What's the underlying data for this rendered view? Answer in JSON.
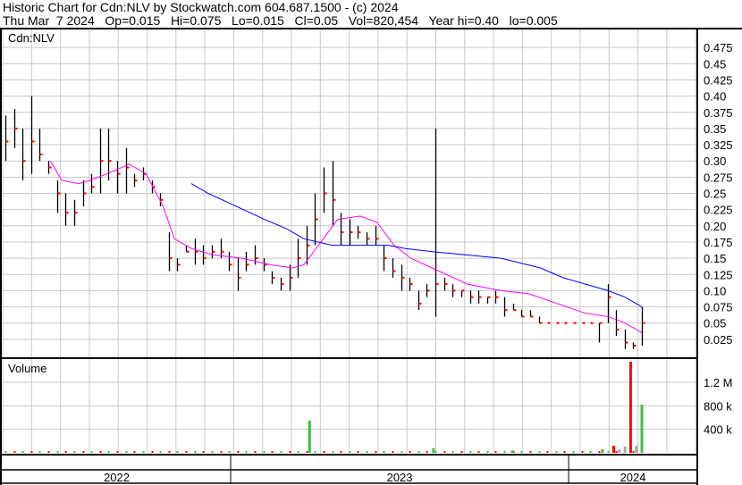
{
  "header": {
    "title": "Historic Chart for Cdn:NLV by Stockwatch.com 604.687.1500 - (c) 2024",
    "quote": "Thu Mar  7 2024   Op=0.015   Hi=0.075   Lo=0.015   Cl=0.05   Vol=820,454   Year hi=0.40   lo=0.005"
  },
  "chart_data": {
    "type": "line",
    "symbol": "Cdn:NLV",
    "price_axis": {
      "ticks": [
        "0.025",
        "0.05",
        "0.075",
        "0.10",
        "0.125",
        "0.15",
        "0.175",
        "0.20",
        "0.225",
        "0.25",
        "0.275",
        "0.30",
        "0.325",
        "0.35",
        "0.375",
        "0.40",
        "0.425",
        "0.45",
        "0.475"
      ],
      "ylim": [
        0,
        0.5
      ]
    },
    "volume_panel": {
      "label": "Volume",
      "ticks": [
        {
          "label": "400 k",
          "value": 400000
        },
        {
          "label": "800 k",
          "value": 800000
        },
        {
          "label": "1.2 M",
          "value": 1200000
        }
      ],
      "ylim": [
        0,
        1550000
      ]
    },
    "x_axis": {
      "unit": "week",
      "xlim": [
        0,
        113
      ],
      "years": [
        {
          "label": "2022",
          "start": 0,
          "end": 40
        },
        {
          "label": "2023",
          "start": 40,
          "end": 100
        },
        {
          "label": "2024",
          "start": 100,
          "end": 113
        }
      ]
    },
    "bars_hlc": [
      [
        0.37,
        0.3,
        0.33
      ],
      [
        0.38,
        0.32,
        0.35
      ],
      [
        0.35,
        0.27,
        0.3
      ],
      [
        0.4,
        0.28,
        0.33
      ],
      [
        0.35,
        0.3,
        0.31
      ],
      [
        0.3,
        0.28,
        0.29
      ],
      [
        0.27,
        0.22,
        0.25
      ],
      [
        0.25,
        0.2,
        0.22
      ],
      [
        0.24,
        0.2,
        0.22
      ],
      [
        0.27,
        0.23,
        0.25
      ],
      [
        0.28,
        0.25,
        0.26
      ],
      [
        0.35,
        0.25,
        0.3
      ],
      [
        0.35,
        0.27,
        0.3
      ],
      [
        0.3,
        0.25,
        0.28
      ],
      [
        0.32,
        0.25,
        0.29
      ],
      [
        0.28,
        0.26,
        0.27
      ],
      [
        0.29,
        0.27,
        0.28
      ],
      [
        0.27,
        0.25,
        0.26
      ],
      [
        0.25,
        0.23,
        0.24
      ],
      [
        0.19,
        0.13,
        0.15
      ],
      [
        0.15,
        0.13,
        0.14
      ],
      [
        0.17,
        0.16,
        0.16
      ],
      [
        0.18,
        0.14,
        0.16
      ],
      [
        0.17,
        0.14,
        0.15
      ],
      [
        0.17,
        0.15,
        0.16
      ],
      [
        0.18,
        0.15,
        0.16
      ],
      [
        0.16,
        0.13,
        0.14
      ],
      [
        0.15,
        0.1,
        0.12
      ],
      [
        0.16,
        0.13,
        0.14
      ],
      [
        0.17,
        0.14,
        0.15
      ],
      [
        0.15,
        0.13,
        0.14
      ],
      [
        0.13,
        0.11,
        0.12
      ],
      [
        0.12,
        0.1,
        0.11
      ],
      [
        0.14,
        0.1,
        0.12
      ],
      [
        0.18,
        0.12,
        0.15
      ],
      [
        0.2,
        0.14,
        0.17
      ],
      [
        0.25,
        0.17,
        0.21
      ],
      [
        0.29,
        0.22,
        0.25
      ],
      [
        0.3,
        0.2,
        0.24
      ],
      [
        0.22,
        0.17,
        0.19
      ],
      [
        0.21,
        0.17,
        0.19
      ],
      [
        0.2,
        0.18,
        0.19
      ],
      [
        0.19,
        0.17,
        0.18
      ],
      [
        0.2,
        0.17,
        0.18
      ],
      [
        0.17,
        0.13,
        0.15
      ],
      [
        0.15,
        0.12,
        0.13
      ],
      [
        0.14,
        0.1,
        0.12
      ],
      [
        0.12,
        0.1,
        0.11
      ],
      [
        0.1,
        0.07,
        0.08
      ],
      [
        0.11,
        0.09,
        0.1
      ],
      [
        0.35,
        0.06,
        0.11
      ],
      [
        0.12,
        0.1,
        0.11
      ],
      [
        0.11,
        0.09,
        0.1
      ],
      [
        0.1,
        0.09,
        0.1
      ],
      [
        0.1,
        0.08,
        0.09
      ],
      [
        0.1,
        0.08,
        0.09
      ],
      [
        0.09,
        0.08,
        0.09
      ],
      [
        0.1,
        0.08,
        0.09
      ],
      [
        0.09,
        0.06,
        0.07
      ],
      [
        0.08,
        0.07,
        0.07
      ],
      [
        0.07,
        0.06,
        0.06
      ],
      [
        0.07,
        0.06,
        0.06
      ],
      [
        0.06,
        0.05,
        0.05
      ],
      [
        0.05,
        0.05,
        0.05
      ],
      [
        0.05,
        0.05,
        0.05
      ],
      [
        0.05,
        0.05,
        0.05
      ],
      [
        0.05,
        0.05,
        0.05
      ],
      [
        0.05,
        0.05,
        0.05
      ],
      [
        0.05,
        0.05,
        0.05
      ],
      [
        0.05,
        0.02,
        0.05
      ],
      [
        0.11,
        0.05,
        0.09
      ],
      [
        0.07,
        0.03,
        0.04
      ],
      [
        0.04,
        0.01,
        0.02
      ],
      [
        0.02,
        0.01,
        0.015
      ],
      [
        0.075,
        0.015,
        0.05
      ]
    ],
    "series": [
      {
        "name": "short moving average",
        "color": "#ff00ff",
        "points": [
          [
            8,
            0.3
          ],
          [
            10,
            0.27
          ],
          [
            13,
            0.265
          ],
          [
            15,
            0.27
          ],
          [
            18,
            0.28
          ],
          [
            22,
            0.295
          ],
          [
            25,
            0.28
          ],
          [
            28,
            0.23
          ],
          [
            30,
            0.18
          ],
          [
            33,
            0.165
          ],
          [
            37,
            0.155
          ],
          [
            42,
            0.15
          ],
          [
            47,
            0.14
          ],
          [
            51,
            0.135
          ],
          [
            53,
            0.14
          ],
          [
            56,
            0.175
          ],
          [
            59,
            0.21
          ],
          [
            63,
            0.215
          ],
          [
            66,
            0.205
          ],
          [
            69,
            0.17
          ],
          [
            72,
            0.15
          ],
          [
            77,
            0.13
          ],
          [
            82,
            0.11
          ],
          [
            88,
            0.1
          ],
          [
            93,
            0.095
          ],
          [
            98,
            0.08
          ],
          [
            103,
            0.065
          ],
          [
            107,
            0.06
          ],
          [
            110,
            0.05
          ],
          [
            113,
            0.035
          ]
        ]
      },
      {
        "name": "long moving average",
        "color": "#0000ff",
        "points": [
          [
            33,
            0.265
          ],
          [
            36,
            0.25
          ],
          [
            41,
            0.23
          ],
          [
            46,
            0.21
          ],
          [
            50,
            0.195
          ],
          [
            53,
            0.18
          ],
          [
            58,
            0.17
          ],
          [
            63,
            0.17
          ],
          [
            68,
            0.17
          ],
          [
            71,
            0.165
          ],
          [
            76,
            0.16
          ],
          [
            82,
            0.155
          ],
          [
            88,
            0.15
          ],
          [
            95,
            0.135
          ],
          [
            99,
            0.12
          ],
          [
            103,
            0.11
          ],
          [
            107,
            0.1
          ],
          [
            110,
            0.09
          ],
          [
            113,
            0.075
          ]
        ]
      }
    ],
    "volume": [
      {
        "x": 54,
        "v": 550000,
        "dir": "up"
      },
      {
        "x": 76,
        "v": 80000,
        "dir": "up"
      },
      {
        "x": 90,
        "v": 40000,
        "dir": "up"
      },
      {
        "x": 106,
        "v": 60000,
        "dir": "up"
      },
      {
        "x": 108,
        "v": 120000,
        "dir": "down"
      },
      {
        "x": 109,
        "v": 60000,
        "dir": "flat"
      },
      {
        "x": 110,
        "v": 110000,
        "dir": "flat"
      },
      {
        "x": 111,
        "v": 1550000,
        "dir": "down"
      },
      {
        "x": 112,
        "v": 120000,
        "dir": "flat"
      },
      {
        "x": 113,
        "v": 820454,
        "dir": "up"
      }
    ],
    "colors": {
      "up": "#44bb44",
      "down": "#ff0000",
      "flat": "#aaaaaa",
      "bar": "#000000",
      "close": "#ff0000",
      "grid": "#c8c8c8"
    }
  }
}
